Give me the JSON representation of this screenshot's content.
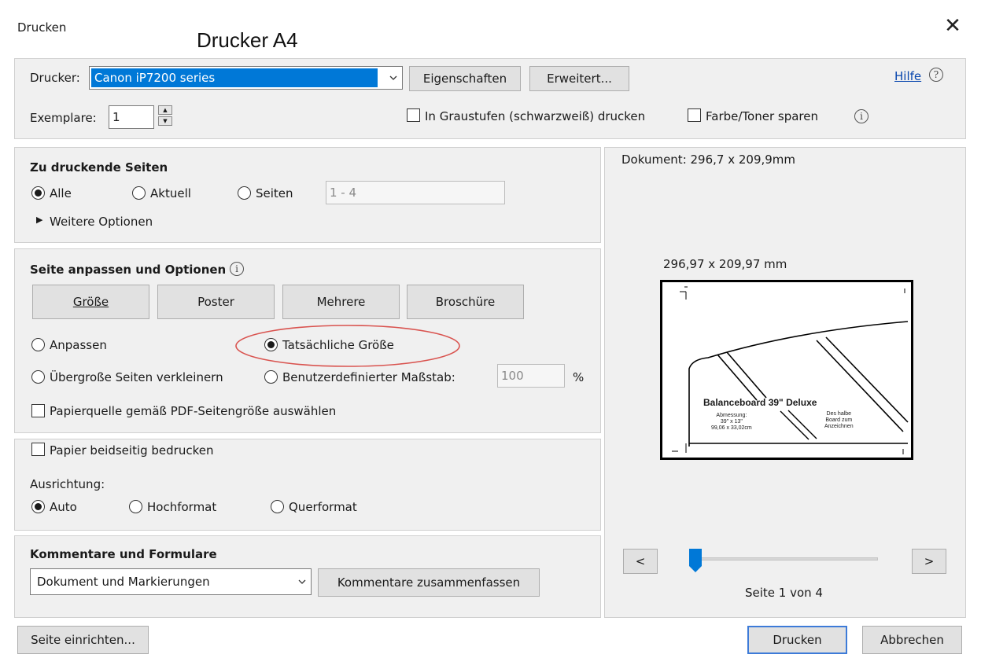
{
  "window": {
    "title": "Drucken",
    "annotation": "Drucker A4"
  },
  "printer": {
    "label": "Drucker:",
    "selected": "Canon iP7200 series",
    "properties_button": "Eigenschaften",
    "advanced_button": "Erweitert...",
    "help_link": "Hilfe",
    "copies_label": "Exemplare:",
    "copies_value": "1",
    "grayscale_label": "In Graustufen (schwarzweiß) drucken",
    "grayscale_checked": false,
    "save_toner_label": "Farbe/Toner sparen",
    "save_toner_checked": false
  },
  "pages_section": {
    "title": "Zu druckende Seiten",
    "options": [
      "Alle",
      "Aktuell",
      "Seiten"
    ],
    "selected": "Alle",
    "range_placeholder": "1 - 4",
    "more_options": "Weitere Optionen"
  },
  "sizing_section": {
    "title": "Seite anpassen und Optionen",
    "tabs": [
      "Größe",
      "Poster",
      "Mehrere",
      "Broschüre"
    ],
    "fit": "Anpassen",
    "actual_size": "Tatsächliche Größe",
    "shrink": "Übergroße Seiten verkleinern",
    "custom_scale": "Benutzerdefinierter Maßstab:",
    "scale_value": "100",
    "scale_unit": "%",
    "selected": "Tatsächliche Größe",
    "paper_source": "Papierquelle gemäß PDF-Seitengröße auswählen",
    "paper_source_checked": false
  },
  "duplex": {
    "label": "Papier beidseitig bedrucken",
    "checked": false,
    "orientation_label": "Ausrichtung:",
    "orientations": [
      "Auto",
      "Hochformat",
      "Querformat"
    ],
    "selected": "Auto"
  },
  "comments": {
    "title": "Kommentare und Formulare",
    "selected": "Dokument und Markierungen",
    "summarize_button": "Kommentare zusammenfassen"
  },
  "preview": {
    "document_size": "Dokument: 296,7 x 209,9mm",
    "page_size": "296,97 x 209,97 mm",
    "page_title": "Balanceboard 39\" Deluxe",
    "dims_text": [
      "Abmessung:",
      "39\" x 13\"",
      "99,06 x 33,02cm"
    ],
    "side_text": [
      "Des halbe",
      "Board zum",
      "Anzeichnen"
    ],
    "prev_label": "<",
    "next_label": ">",
    "page_status": "Seite 1 von 4",
    "slider_fraction": 0.0
  },
  "footer": {
    "page_setup_button": "Seite einrichten...",
    "print_button": "Drucken",
    "cancel_button": "Abbrechen"
  },
  "colors": {
    "accent": "#0078d7",
    "highlight_ellipse": "#d9534f",
    "link": "#0645ad"
  }
}
